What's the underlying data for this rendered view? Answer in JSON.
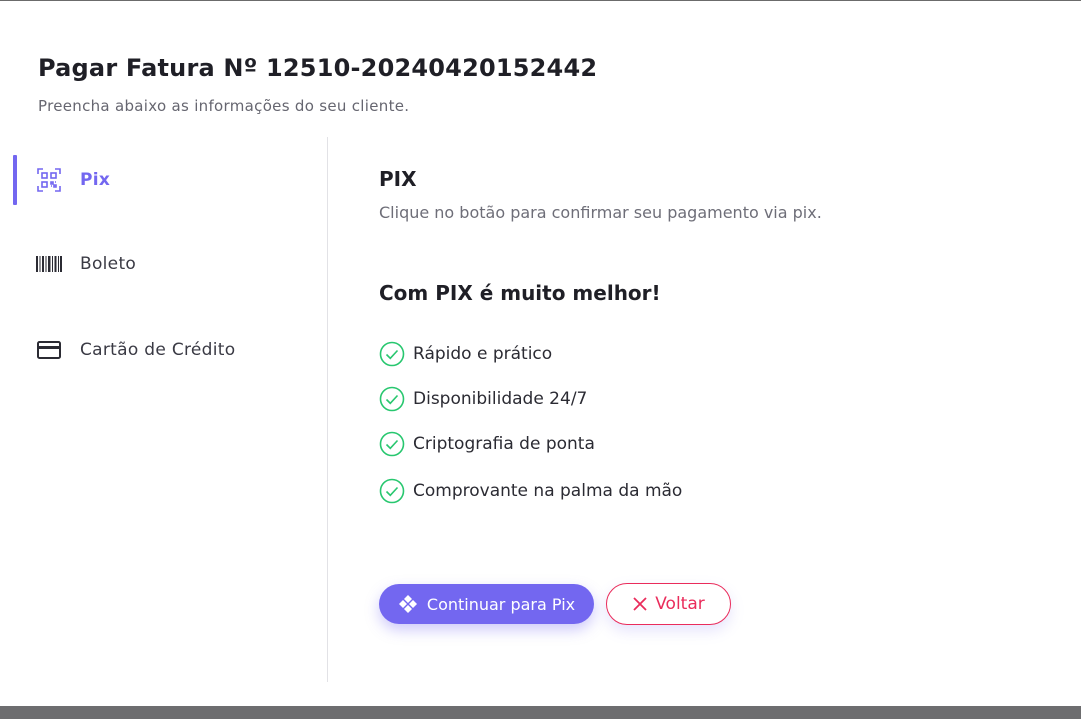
{
  "header": {
    "title": "Pagar Fatura Nº 12510-20240420152442",
    "subtitle": "Preencha abaixo as informações do seu cliente."
  },
  "sidebar": {
    "items": [
      {
        "label": "Pix",
        "icon": "qr-code-icon",
        "active": true
      },
      {
        "label": "Boleto",
        "icon": "barcode-icon",
        "active": false
      },
      {
        "label": "Cartão de Crédito",
        "icon": "credit-card-icon",
        "active": false
      }
    ]
  },
  "main": {
    "title": "PIX",
    "description": "Clique no botão para confirmar seu pagamento via pix.",
    "benefits_title": "Com PIX é muito melhor!",
    "benefits": [
      {
        "text": "Rápido e prático",
        "icon": "check-circle-icon"
      },
      {
        "text": "Disponibilidade 24/7",
        "icon": "check-circle-icon"
      },
      {
        "text": "Criptografia de ponta",
        "icon": "check-circle-icon"
      },
      {
        "text": "Comprovante na palma da mão",
        "icon": "check-circle-icon"
      }
    ],
    "continue_button": {
      "label": "Continuar para Pix",
      "icon": "pix-icon"
    },
    "back_button": {
      "label": "Voltar",
      "icon": "close-icon"
    }
  },
  "colors": {
    "accent": "#7367f0",
    "danger": "#ea2c5b",
    "success": "#28c76f",
    "text": "#1f1f26",
    "muted": "#6e6e78"
  }
}
